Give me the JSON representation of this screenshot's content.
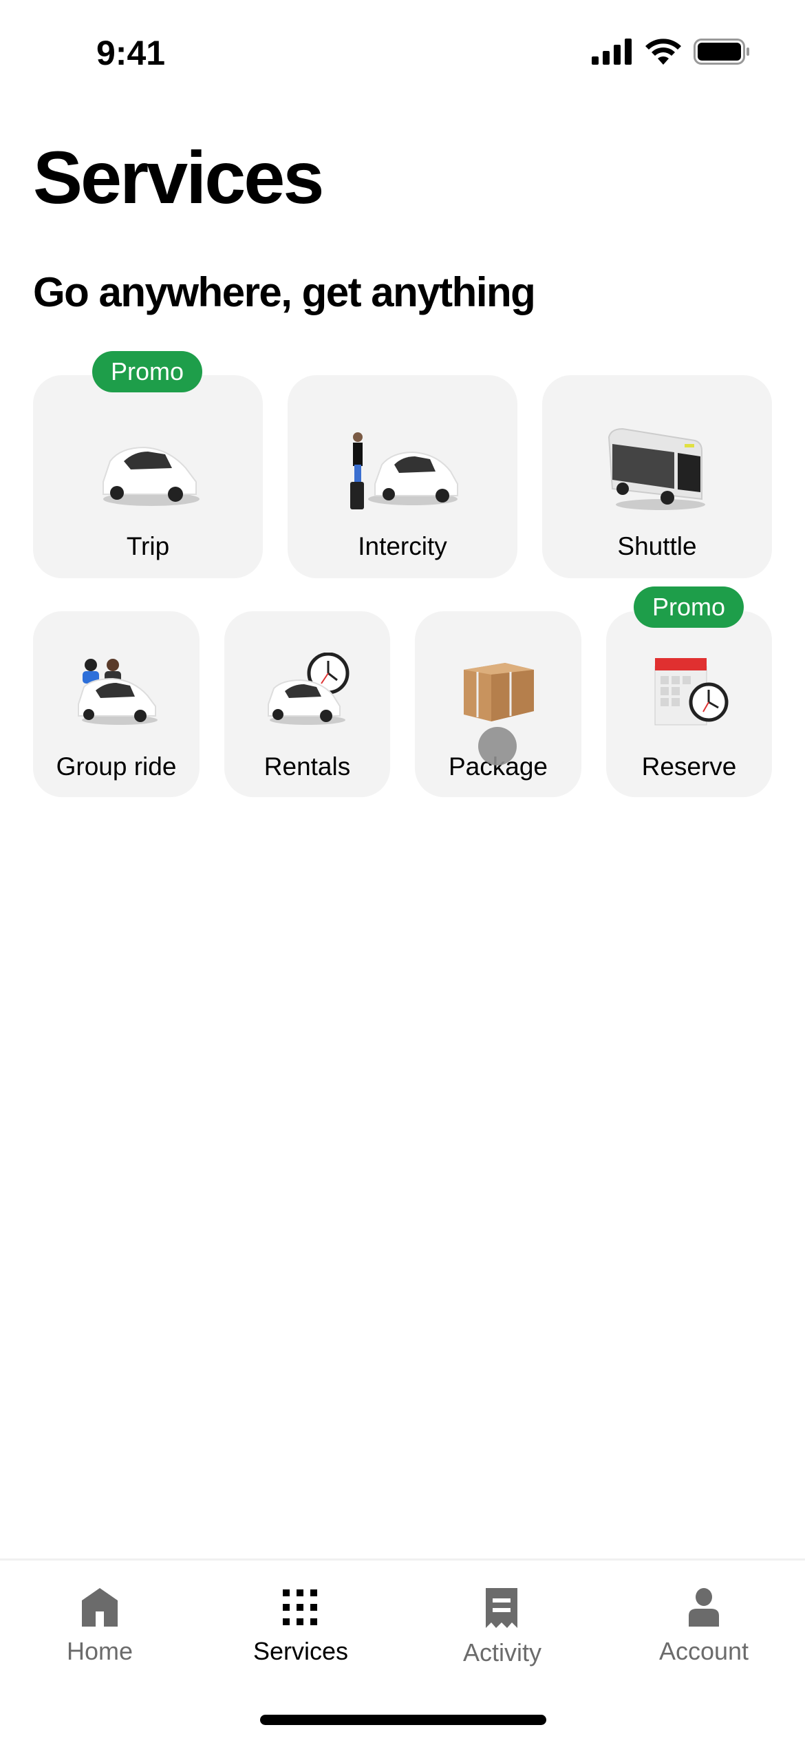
{
  "status_bar": {
    "time": "9:41",
    "icons": [
      "signal-icon",
      "wifi-icon",
      "battery-icon"
    ]
  },
  "header": {
    "title": "Services",
    "subtitle": "Go anywhere, get anything"
  },
  "services": [
    {
      "label": "Trip",
      "icon": "car-icon",
      "badge": "Promo"
    },
    {
      "label": "Intercity",
      "icon": "traveler-car-icon"
    },
    {
      "label": "Shuttle",
      "icon": "bus-icon"
    },
    {
      "label": "Group ride",
      "icon": "group-car-icon"
    },
    {
      "label": "Rentals",
      "icon": "car-clock-icon"
    },
    {
      "label": "Package",
      "icon": "package-icon"
    },
    {
      "label": "Reserve",
      "icon": "calendar-clock-icon",
      "badge": "Promo"
    }
  ],
  "colors": {
    "promo": "#1e9e4a",
    "tile": "#f3f3f3",
    "inactive_tab": "#6b6b6b"
  },
  "tabbar": {
    "items": [
      {
        "label": "Home",
        "icon": "home-icon"
      },
      {
        "label": "Services",
        "icon": "grid-icon",
        "active": true
      },
      {
        "label": "Activity",
        "icon": "receipt-icon"
      },
      {
        "label": "Account",
        "icon": "person-icon"
      }
    ]
  }
}
